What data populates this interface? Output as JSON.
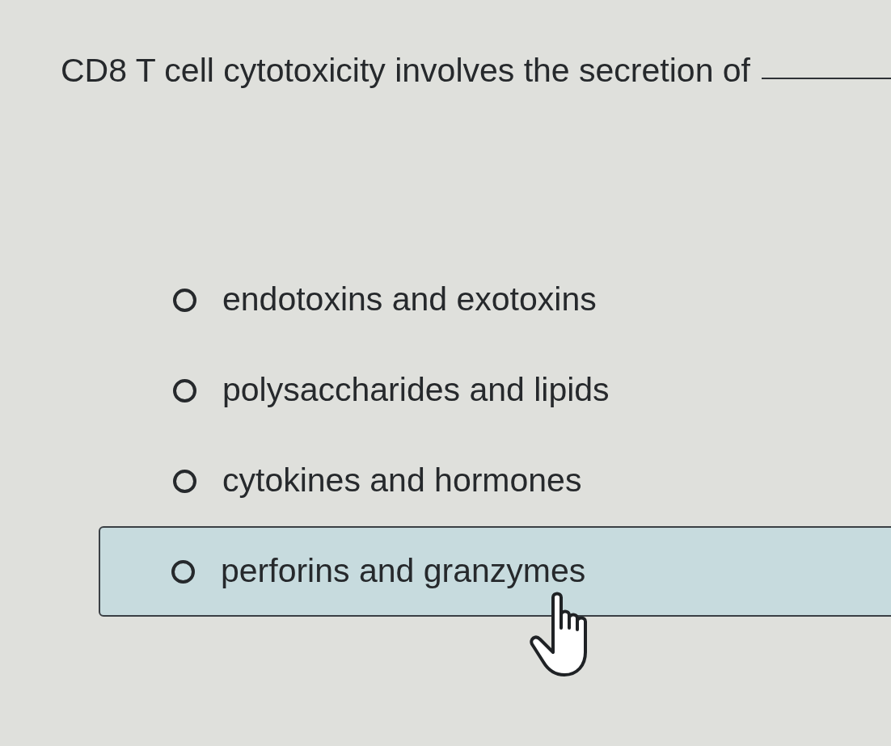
{
  "question": {
    "text": "CD8 T cell cytotoxicity involves the secretion of"
  },
  "options": [
    {
      "label": "endotoxins and exotoxins",
      "selected": false,
      "highlighted": false
    },
    {
      "label": "polysaccharides and lipids",
      "selected": false,
      "highlighted": false
    },
    {
      "label": "cytokines and hormones",
      "selected": false,
      "highlighted": false
    },
    {
      "label": "perforins and granzymes",
      "selected": false,
      "highlighted": true
    }
  ]
}
